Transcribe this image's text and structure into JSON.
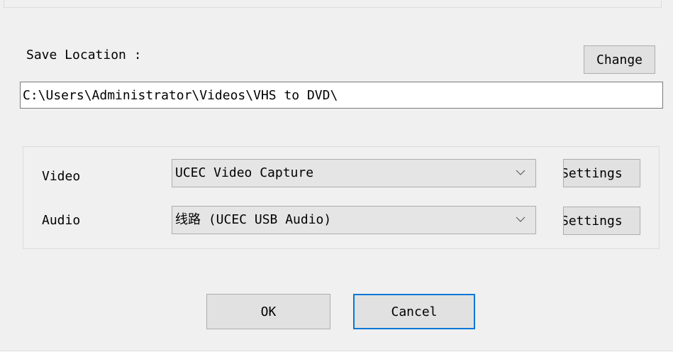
{
  "save_location": {
    "label": "Save Location :",
    "change_label": "Change",
    "path": "C:\\Users\\Administrator\\Videos\\VHS to DVD\\"
  },
  "devices": {
    "video": {
      "label": "Video",
      "selected": "UCEC Video Capture",
      "settings_label": "Settings"
    },
    "audio": {
      "label": "Audio",
      "selected": "线路 (UCEC USB Audio)",
      "settings_label": "Settings"
    }
  },
  "buttons": {
    "ok_label": "OK",
    "cancel_label": "Cancel"
  },
  "icons": {
    "dropdown": "chevron-down-icon"
  },
  "colors": {
    "dialog_bg": "#f0f0f0",
    "button_bg": "#e1e1e1",
    "focus_border": "#0078d7"
  }
}
